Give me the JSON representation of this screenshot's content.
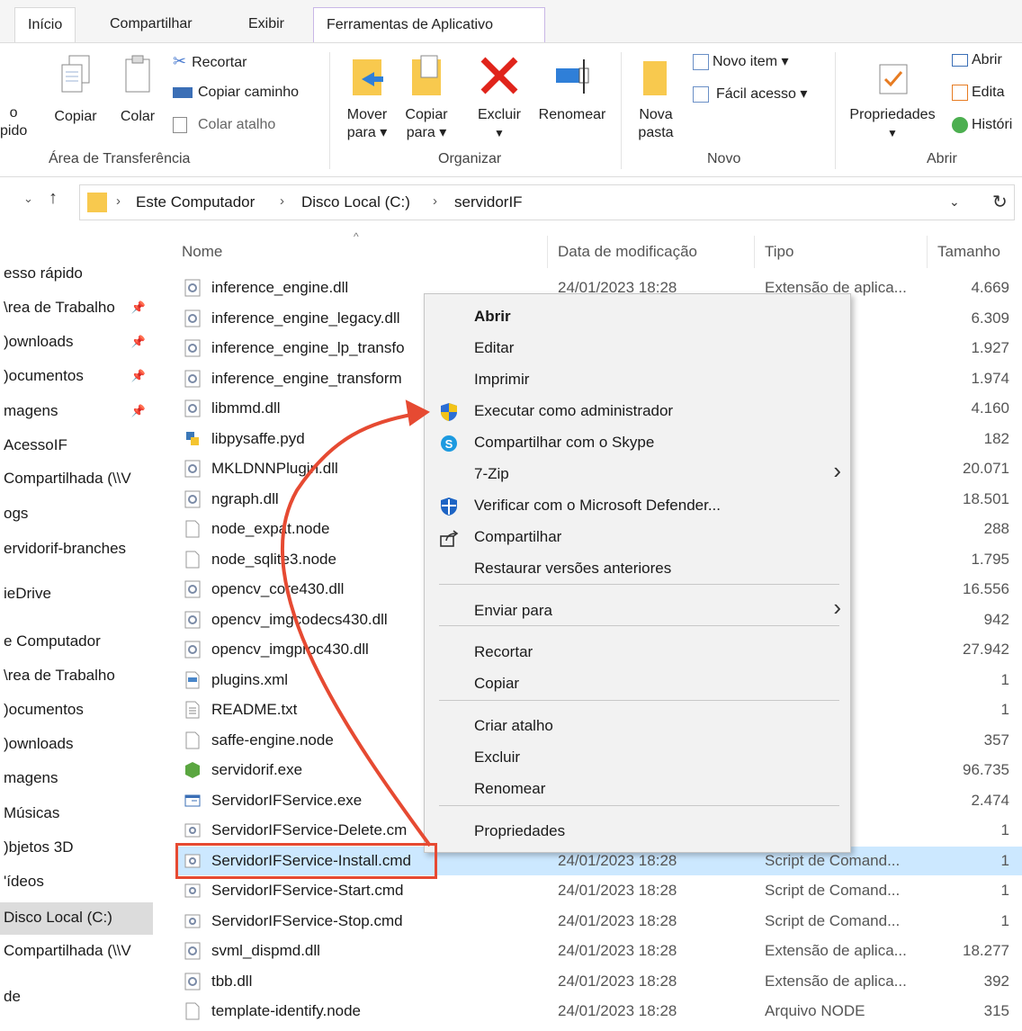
{
  "ribbon_tabs": [
    {
      "label": "Início"
    },
    {
      "label": "Compartilhar"
    },
    {
      "label": "Exibir"
    },
    {
      "label": "Ferramentas de Aplicativo"
    }
  ],
  "ribbon": {
    "clipboard": {
      "pin_label_1": "o",
      "pin_label_2": "pido",
      "copy": "Copiar",
      "paste": "Colar",
      "cut": "Recortar",
      "copy_path": "Copiar caminho",
      "paste_shortcut": "Colar atalho",
      "group": "Área de Transferência"
    },
    "organize": {
      "move_to_1": "Mover",
      "move_to_2": "para ▾",
      "copy_to_1": "Copiar",
      "copy_to_2": "para ▾",
      "delete": "Excluir",
      "rename": "Renomear",
      "group": "Organizar"
    },
    "new": {
      "new_folder_1": "Nova",
      "new_folder_2": "pasta",
      "new_item": "Novo item ▾",
      "easy_access": "Fácil acesso ▾",
      "group": "Novo"
    },
    "open": {
      "properties": "Propriedades",
      "open": "Abrir",
      "edit": "Edita",
      "history": "Históri",
      "group": "Abrir"
    }
  },
  "address": {
    "crumbs": [
      "Este Computador",
      "Disco Local (C:)",
      "servidorIF"
    ]
  },
  "nav": [
    {
      "label": "esso rápido",
      "pinned": false
    },
    {
      "label": "\\rea de Trabalho",
      "pinned": true
    },
    {
      "label": ")ownloads",
      "pinned": true
    },
    {
      "label": ")ocumentos",
      "pinned": true
    },
    {
      "label": "magens",
      "pinned": true
    },
    {
      "label": "AcessoIF",
      "pinned": false
    },
    {
      "label": "Compartilhada (\\\\V",
      "pinned": false
    },
    {
      "label": "ogs",
      "pinned": false
    },
    {
      "label": "ervidorif-branches",
      "pinned": false
    },
    {
      "label": "ieDrive",
      "pinned": false
    },
    {
      "label": "e Computador",
      "pinned": false
    },
    {
      "label": "\\rea de Trabalho",
      "pinned": false
    },
    {
      "label": ")ocumentos",
      "pinned": false
    },
    {
      "label": ")ownloads",
      "pinned": false
    },
    {
      "label": "magens",
      "pinned": false
    },
    {
      "label": "Músicas",
      "pinned": false
    },
    {
      "label": ")bjetos 3D",
      "pinned": false
    },
    {
      "label": "'ídeos",
      "pinned": false
    },
    {
      "label": "Disco Local (C:)",
      "pinned": false
    },
    {
      "label": "Compartilhada (\\\\V",
      "pinned": false
    },
    {
      "label": "de",
      "pinned": false
    }
  ],
  "columns": {
    "name": "Nome",
    "date": "Data de modificação",
    "type": "Tipo",
    "size": "Tamanho"
  },
  "files": [
    {
      "name": "inference_engine.dll",
      "date": "24/01/2023 18:28",
      "type": "Extensão de aplica...",
      "size": "4.669",
      "icon": "dll-icon"
    },
    {
      "name": "inference_engine_legacy.dll",
      "date": "",
      "type": "aplica...",
      "size": "6.309",
      "icon": "dll-icon"
    },
    {
      "name": "inference_engine_lp_transfo",
      "date": "",
      "type": "aplica...",
      "size": "1.927",
      "icon": "dll-icon"
    },
    {
      "name": "inference_engine_transform",
      "date": "",
      "type": "aplica...",
      "size": "1.974",
      "icon": "dll-icon"
    },
    {
      "name": "libmmd.dll",
      "date": "",
      "type": "aplica...",
      "size": "4.160",
      "icon": "dll-icon"
    },
    {
      "name": "libpysaffe.pyd",
      "date": "",
      "type": "sion ...",
      "size": "182",
      "icon": "python-icon"
    },
    {
      "name": "MKLDNNPlugin.dll",
      "date": "",
      "type": "aplica...",
      "size": "20.071",
      "icon": "dll-icon"
    },
    {
      "name": "ngraph.dll",
      "date": "",
      "type": "aplica...",
      "size": "18.501",
      "icon": "dll-icon"
    },
    {
      "name": "node_expat.node",
      "date": "",
      "type": "E",
      "size": "288",
      "icon": "file-icon"
    },
    {
      "name": "node_sqlite3.node",
      "date": "",
      "type": "E",
      "size": "1.795",
      "icon": "file-icon"
    },
    {
      "name": "opencv_core430.dll",
      "date": "",
      "type": "aplica...",
      "size": "16.556",
      "icon": "dll-icon"
    },
    {
      "name": "opencv_imgcodecs430.dll",
      "date": "",
      "type": "aplica...",
      "size": "942",
      "icon": "dll-icon"
    },
    {
      "name": "opencv_imgproc430.dll",
      "date": "",
      "type": "aplica...",
      "size": "27.942",
      "icon": "dll-icon"
    },
    {
      "name": "plugins.xml",
      "date": "",
      "type": "XML",
      "size": "1",
      "icon": "xml-icon"
    },
    {
      "name": "README.txt",
      "date": "",
      "type": "de Te...",
      "size": "1",
      "icon": "text-icon"
    },
    {
      "name": "saffe-engine.node",
      "date": "",
      "type": "E",
      "size": "357",
      "icon": "file-icon"
    },
    {
      "name": "servidorif.exe",
      "date": "",
      "type": "",
      "size": "96.735",
      "icon": "exe-green-icon"
    },
    {
      "name": "ServidorIFService.exe",
      "date": "",
      "type": "",
      "size": "2.474",
      "icon": "exe-window-icon"
    },
    {
      "name": "ServidorIFService-Delete.cm",
      "date": "",
      "type": "and...",
      "size": "1",
      "icon": "cmd-icon"
    },
    {
      "name": "ServidorIFService-Install.cmd",
      "date": "24/01/2023 18:28",
      "type": "Script de Comand...",
      "size": "1",
      "icon": "cmd-icon",
      "selected": true
    },
    {
      "name": "ServidorIFService-Start.cmd",
      "date": "24/01/2023 18:28",
      "type": "Script de Comand...",
      "size": "1",
      "icon": "cmd-icon"
    },
    {
      "name": "ServidorIFService-Stop.cmd",
      "date": "24/01/2023 18:28",
      "type": "Script de Comand...",
      "size": "1",
      "icon": "cmd-icon"
    },
    {
      "name": "svml_dispmd.dll",
      "date": "24/01/2023 18:28",
      "type": "Extensão de aplica...",
      "size": "18.277",
      "icon": "dll-icon"
    },
    {
      "name": "tbb.dll",
      "date": "24/01/2023 18:28",
      "type": "Extensão de aplica...",
      "size": "392",
      "icon": "dll-icon"
    },
    {
      "name": "template-identify.node",
      "date": "24/01/2023 18:28",
      "type": "Arquivo NODE",
      "size": "315",
      "icon": "file-icon"
    }
  ],
  "context_menu": [
    {
      "label": "Abrir",
      "bold": true,
      "icon": ""
    },
    {
      "label": "Editar",
      "icon": ""
    },
    {
      "label": "Imprimir",
      "icon": ""
    },
    {
      "label": "Executar como administrador",
      "icon": "uac-shield-icon"
    },
    {
      "label": "Compartilhar com o Skype",
      "icon": "skype-icon"
    },
    {
      "label": "7-Zip",
      "icon": "",
      "submenu": true
    },
    {
      "label": "Verificar com o Microsoft Defender...",
      "icon": "defender-icon"
    },
    {
      "label": "Compartilhar",
      "icon": "share-icon"
    },
    {
      "label": "Restaurar versões anteriores",
      "icon": ""
    },
    {
      "label": "Enviar para",
      "icon": "",
      "submenu": true
    },
    {
      "label": "Recortar",
      "icon": ""
    },
    {
      "label": "Copiar",
      "icon": ""
    },
    {
      "label": "Criar atalho",
      "icon": ""
    },
    {
      "label": "Excluir",
      "icon": ""
    },
    {
      "label": "Renomear",
      "icon": ""
    },
    {
      "label": "Propriedades",
      "icon": ""
    }
  ],
  "colors": {
    "selection": "#cce8ff",
    "annotation": "#e64a32",
    "menu_bg": "#f2f2f2",
    "folder": "#f8c94e"
  }
}
